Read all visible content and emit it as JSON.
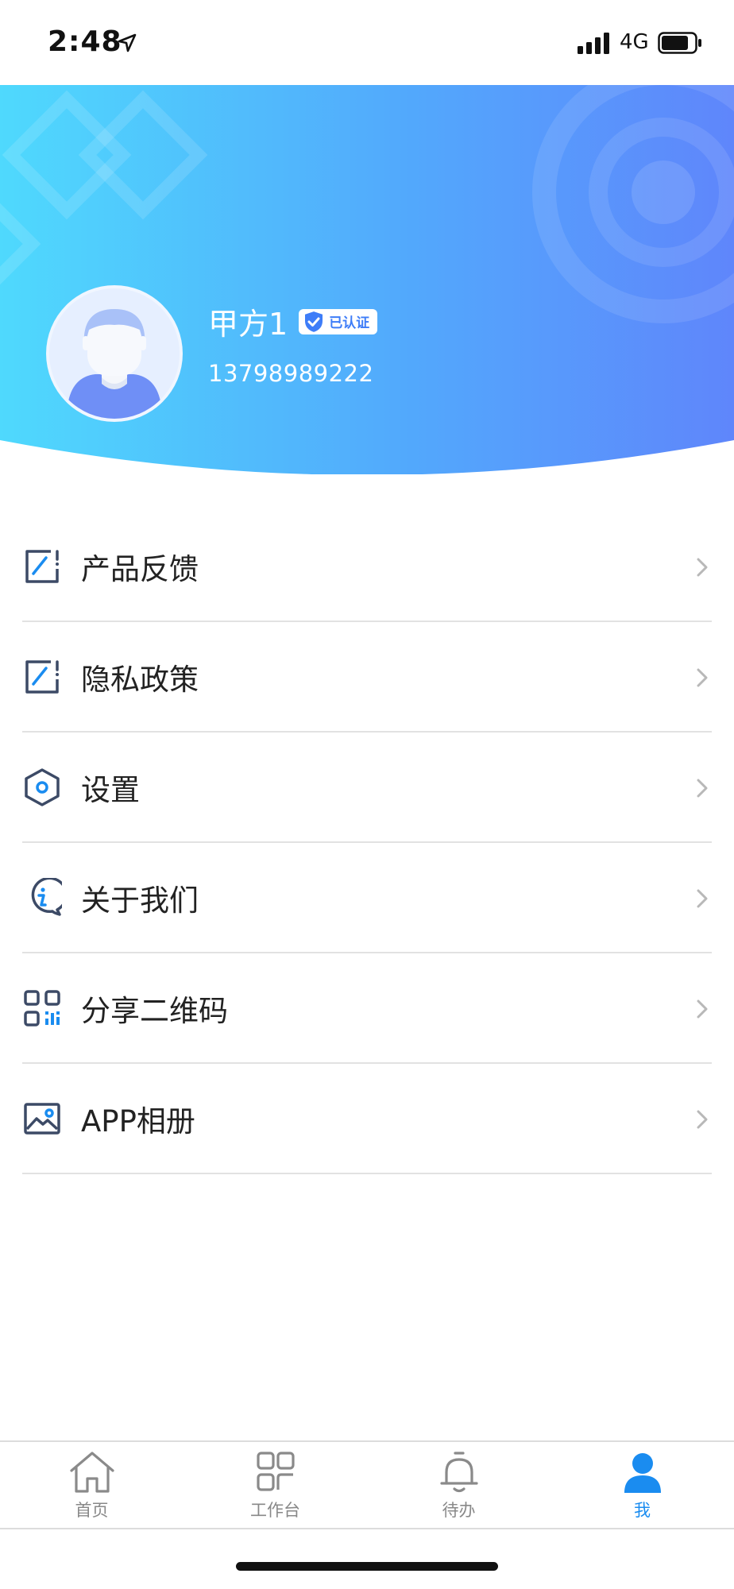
{
  "status_bar": {
    "time": "2:48",
    "network": "4G"
  },
  "profile": {
    "name": "甲方1",
    "verified_label": "已认证",
    "phone": "13798989222"
  },
  "colors": {
    "header_start": "#4fd9fd",
    "header_end": "#5f86fb",
    "accent": "#1a8cf0",
    "icon_stroke": "#3c4a66"
  },
  "menu": {
    "items": [
      {
        "label": "产品反馈",
        "icon": "feedback-icon"
      },
      {
        "label": "隐私政策",
        "icon": "privacy-icon"
      },
      {
        "label": "设置",
        "icon": "settings-icon"
      },
      {
        "label": "关于我们",
        "icon": "info-icon"
      },
      {
        "label": "分享二维码",
        "icon": "qr-code-icon"
      },
      {
        "label": "APP相册",
        "icon": "album-icon"
      }
    ]
  },
  "tabs": [
    {
      "label": "首页",
      "icon": "home-icon",
      "active": false
    },
    {
      "label": "工作台",
      "icon": "workbench-icon",
      "active": false
    },
    {
      "label": "待办",
      "icon": "bell-icon",
      "active": false
    },
    {
      "label": "我",
      "icon": "person-icon",
      "active": true
    }
  ]
}
